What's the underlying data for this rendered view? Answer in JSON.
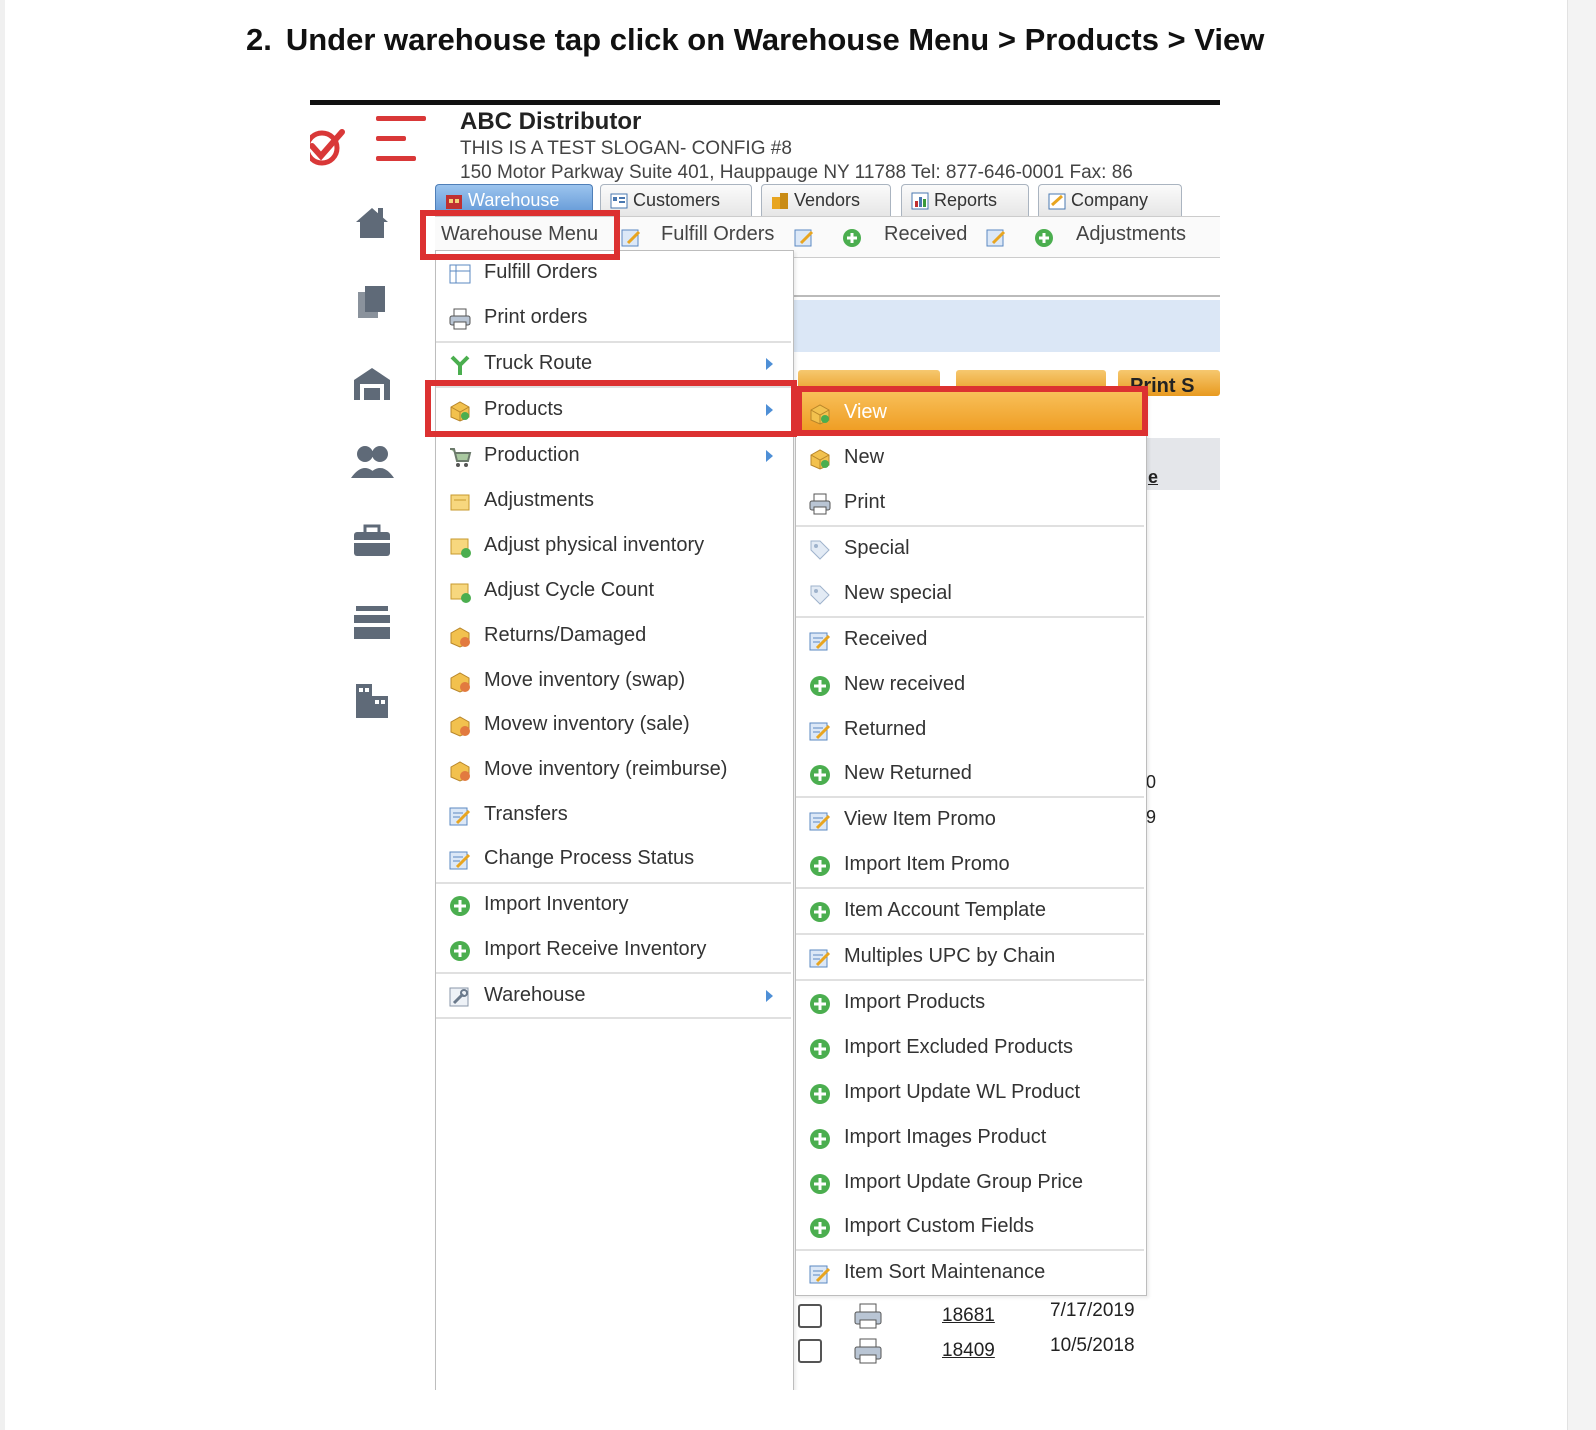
{
  "instruction": {
    "number": "2.",
    "text": "Under warehouse tap click on Warehouse Menu > Products > View"
  },
  "header": {
    "company": "ABC Distributor",
    "slogan": "THIS IS A TEST SLOGAN- CONFIG #8",
    "address": "150 Motor Parkway Suite 401, Hauppauge NY 11788 Tel: 877-646-0001 Fax: 86"
  },
  "tabs": [
    {
      "label": "Warehouse",
      "active": true
    },
    {
      "label": "Customers"
    },
    {
      "label": "Vendors"
    },
    {
      "label": "Reports"
    },
    {
      "label": "Company"
    }
  ],
  "menubar": {
    "warehouse_menu": "Warehouse Menu",
    "fulfill_orders": "Fulfill Orders",
    "received": "Received",
    "adjustments": "Adjustments"
  },
  "background": {
    "button_fragment": "Print S",
    "col_fragment": "e",
    "num_fragment_1": "0",
    "num_fragment_2": "9"
  },
  "warehouse_menu_items": [
    {
      "label": "Fulfill Orders",
      "icon": "grid-icon"
    },
    {
      "label": "Print orders",
      "icon": "printer-icon"
    },
    {
      "label": "Truck Route",
      "icon": "route-icon",
      "submenu": true
    },
    {
      "label": "Products",
      "icon": "box-icon",
      "submenu": true
    },
    {
      "label": "Production",
      "icon": "cart-icon",
      "submenu": true
    },
    {
      "label": "Adjustments",
      "icon": "note-icon"
    },
    {
      "label": "Adjust physical inventory",
      "icon": "note-plus-icon"
    },
    {
      "label": "Adjust Cycle Count",
      "icon": "note-plus-icon"
    },
    {
      "label": "Returns/Damaged",
      "icon": "box-minus-icon"
    },
    {
      "label": "Move inventory (swap)",
      "icon": "box-minus-icon"
    },
    {
      "label": "Movew inventory (sale)",
      "icon": "box-minus-icon"
    },
    {
      "label": "Move inventory (reimburse)",
      "icon": "box-minus-icon"
    },
    {
      "label": "Transfers",
      "icon": "edit-icon"
    },
    {
      "label": "Change Process Status",
      "icon": "edit-icon"
    },
    {
      "label": "Import Inventory",
      "icon": "add-circle-icon"
    },
    {
      "label": "Import Receive Inventory",
      "icon": "add-circle-icon"
    },
    {
      "label": "Warehouse",
      "icon": "wrench-icon",
      "submenu": true
    }
  ],
  "products_submenu_items": [
    {
      "label": "View",
      "icon": "box-icon",
      "selected": true
    },
    {
      "label": "New",
      "icon": "box-icon"
    },
    {
      "label": "Print",
      "icon": "printer-icon"
    },
    {
      "label": "Special",
      "icon": "tag-icon"
    },
    {
      "label": "New special",
      "icon": "tag-icon"
    },
    {
      "label": "Received",
      "icon": "edit-icon"
    },
    {
      "label": "New received",
      "icon": "add-circle-icon"
    },
    {
      "label": "Returned",
      "icon": "edit-icon"
    },
    {
      "label": "New Returned",
      "icon": "add-circle-icon"
    },
    {
      "label": "View Item Promo",
      "icon": "edit-icon"
    },
    {
      "label": "Import Item Promo",
      "icon": "add-circle-icon"
    },
    {
      "label": "Item Account Template",
      "icon": "add-circle-icon"
    },
    {
      "label": "Multiples UPC by Chain",
      "icon": "edit-icon"
    },
    {
      "label": "Import Products",
      "icon": "add-circle-icon"
    },
    {
      "label": "Import Excluded Products",
      "icon": "add-circle-icon"
    },
    {
      "label": "Import Update WL Product",
      "icon": "add-circle-icon"
    },
    {
      "label": "Import Images Product",
      "icon": "add-circle-icon"
    },
    {
      "label": "Import Update Group Price",
      "icon": "add-circle-icon"
    },
    {
      "label": "Import Custom Fields",
      "icon": "add-circle-icon"
    },
    {
      "label": "Item Sort Maintenance",
      "icon": "edit-icon"
    }
  ],
  "rows": [
    {
      "number": "18681",
      "date": "7/17/2019"
    },
    {
      "number": "18409",
      "date": "10/5/2018"
    }
  ],
  "colors": {
    "highlight": "#dc3131",
    "selected": "#ee9a1e",
    "tab_active": "#5f96d5"
  }
}
